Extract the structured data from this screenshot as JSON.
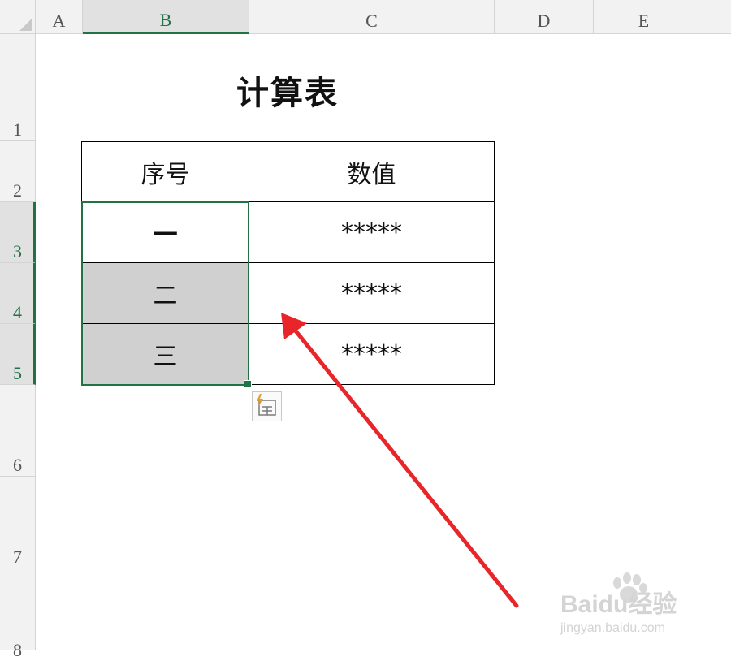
{
  "columns": [
    "A",
    "B",
    "C",
    "D",
    "E"
  ],
  "rows": [
    "1",
    "2",
    "3",
    "4",
    "5",
    "6",
    "7",
    "8"
  ],
  "title": "计算表",
  "table": {
    "headers": [
      "序号",
      "数值"
    ],
    "rows": [
      {
        "index": "一",
        "value": "*****"
      },
      {
        "index": "二",
        "value": "*****"
      },
      {
        "index": "三",
        "value": "*****"
      }
    ]
  },
  "selection": {
    "range": "B3:B5",
    "accent_color": "#217346"
  },
  "highlight_fill": "#d0d0d0",
  "annotation": {
    "arrow_color": "#e8262a"
  },
  "watermark": {
    "brand": "Baidu经验",
    "url": "jingyan.baidu.com"
  }
}
